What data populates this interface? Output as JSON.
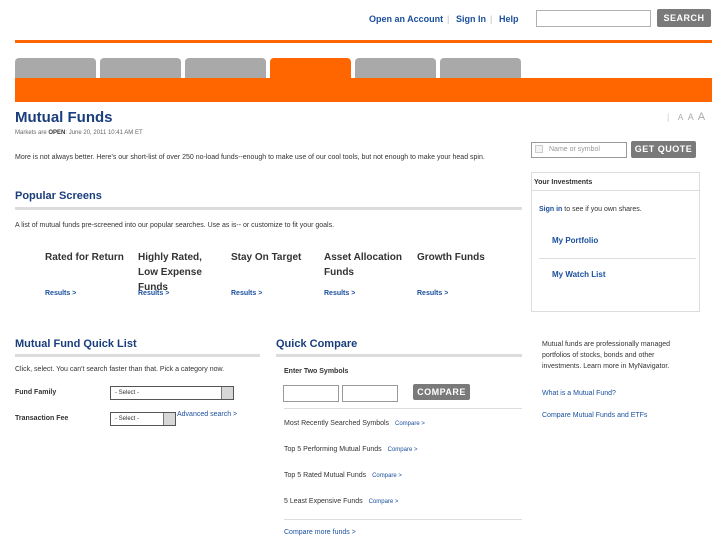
{
  "utility": {
    "open_account": "Open an Account",
    "sign_in": "Sign In",
    "help": "Help",
    "search_button": "SEARCH"
  },
  "page": {
    "title": "Mutual Funds",
    "status_prefix": "Markets are ",
    "status_open": "OPEN",
    "status_suffix": ": June 20, 2011  10:41 AM ET",
    "font_sizes": [
      "A",
      "A",
      "A"
    ],
    "intro": "More is not always better. Here's our short-list of over 250 no-load funds--enough to make use of our cool tools, but not enough to make your head spin."
  },
  "quote": {
    "placeholder": "Name or symbol",
    "button": "GET QUOTE"
  },
  "your_investments": {
    "title": "Your Investments",
    "sign_in": "Sign in",
    "sign_in_suffix": " to see if you own shares.",
    "portfolio": "My Portfolio",
    "watch_list": "My Watch List"
  },
  "popular_screens": {
    "title": "Popular Screens",
    "description": "A list of mutual funds pre-screened into our popular searches. Use as is-- or customize to fit your goals.",
    "screens": [
      {
        "title": "Rated for Return",
        "link": "Results >"
      },
      {
        "title": "Highly Rated, Low Expense Funds",
        "link": "Results >"
      },
      {
        "title": "Stay On Target",
        "link": "Results >"
      },
      {
        "title": "Asset Allocation Funds",
        "link": "Results >"
      },
      {
        "title": "Growth Funds",
        "link": "Results >"
      }
    ]
  },
  "quick_list": {
    "title": "Mutual Fund Quick List",
    "description": "Click, select. You can't search faster than that. Pick a category now.",
    "fund_family_label": "Fund Family",
    "fund_family_value": "- Select -",
    "transaction_fee_label": "Transaction Fee",
    "transaction_fee_value": "- Select -",
    "advanced_search": "Advanced search >"
  },
  "quick_compare": {
    "title": "Quick Compare",
    "enter_symbols": "Enter Two Symbols",
    "compare_button": "COMPARE",
    "lists": [
      {
        "label": "Most Recently Searched Symbols",
        "link": "Compare >"
      },
      {
        "label": "Top 5 Performing Mutual Funds",
        "link": "Compare >"
      },
      {
        "label": "Top 5 Rated Mutual Funds",
        "link": "Compare >"
      },
      {
        "label": "5 Least Expensive Funds",
        "link": "Compare >"
      }
    ],
    "compare_more": "Compare more funds >"
  },
  "side_info": {
    "text": "Mutual funds are professionally managed portfolios of stocks, bonds and other investments. Learn more in MyNavigator.",
    "link1": "What is a Mutual Fund?",
    "link2": "Compare Mutual Funds and ETFs"
  },
  "colors": {
    "accent": "#ff6600",
    "title_blue": "#1a3d7c",
    "link_blue": "#1a4f9c",
    "tab_gray": "#a9a9a9"
  }
}
